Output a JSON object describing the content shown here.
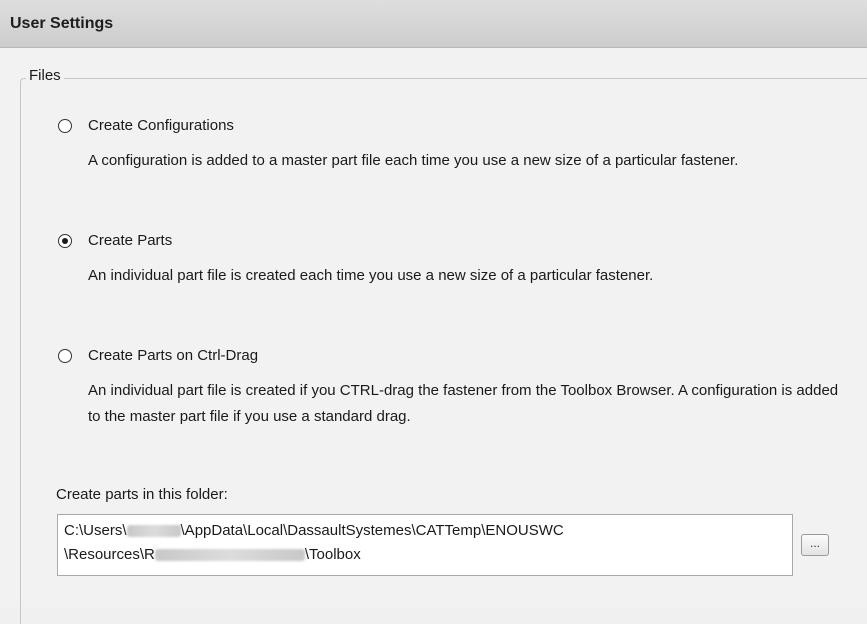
{
  "header": {
    "title": "User Settings"
  },
  "files_group": {
    "legend": "Files",
    "options": [
      {
        "label": "Create Configurations",
        "description": "A configuration is added to a master part file each time you use a new size of a particular fastener.",
        "checked": false
      },
      {
        "label": "Create Parts",
        "description": "An individual part file is created each time you use a new size of a particular fastener.",
        "checked": true
      },
      {
        "label": "Create Parts on Ctrl-Drag",
        "description": "An individual part file is created if you CTRL-drag the fastener from the Toolbox Browser. A configuration is added to the master part file if you use a standard drag.",
        "checked": false
      }
    ],
    "folder_label": "Create parts in this folder:",
    "folder_path": {
      "line1_a": "C:\\Users\\",
      "line1_b": "\\AppData\\Local\\DassaultSystemes\\CATTemp\\ENOUSWC",
      "line2_a": "\\Resources\\R",
      "line2_b": "\\Toolbox"
    },
    "browse_label": "..."
  },
  "colors": {
    "header_bg": "#d4d4d4",
    "panel_bg": "#f2f2f2"
  }
}
